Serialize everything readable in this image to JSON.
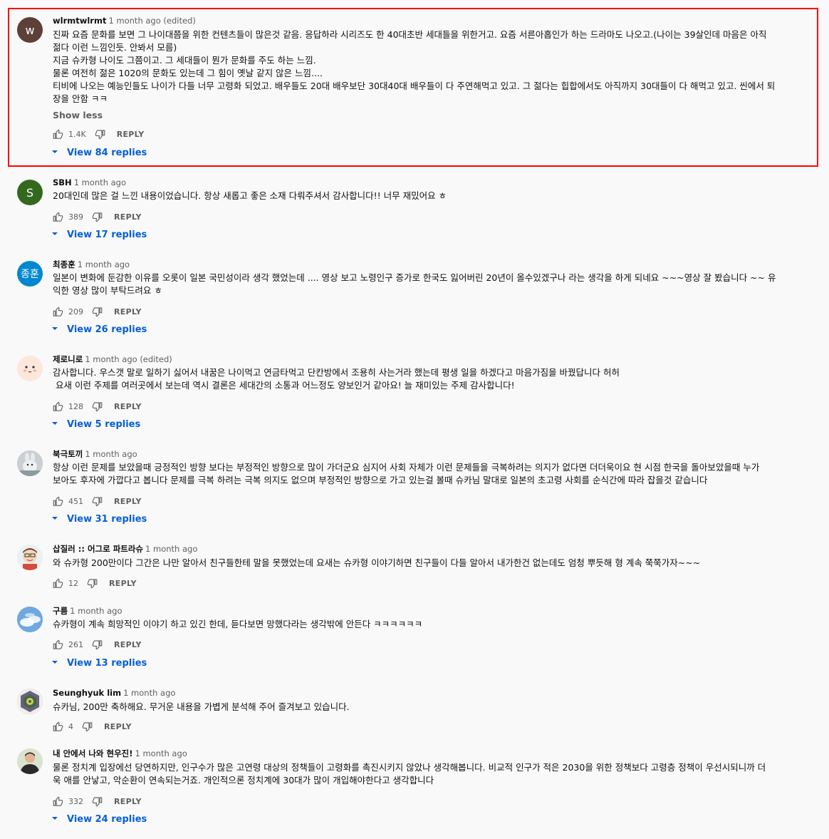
{
  "comments": [
    {
      "author": "wlrmtwlrmt",
      "time": "1 month ago (edited)",
      "avatar": {
        "kind": "letter",
        "letter": "w",
        "color": "#5d4037"
      },
      "text": "진짜 요즘 문화를 보면 그 나이대쯤을 위한 컨텐츠들이 많은것 같음. 응답하라 시리즈도 한 40대초반 세대들을 위한거고. 요즘 서른아홉인가 하는 드라마도 나오고.(나이는 39살인데 마음은 아직\n젊다 이런 느낌인듯. 안봐서 모름)\n지금 슈카형 나이도 그쯤이고. 그 세대들이 뭔가 문화를 주도 하는 느낌.\n물론 여전히 젊은 1020의 문화도 있는데 그 힘이 옛날 같지 않은 느낌....\n티비에 나오는 예능인들도 나이가 다들 너무 고령화 되었고. 배우들도 20대 배우보단 30대40대 배우들이 다 주연해먹고 있고. 그 젊다는 힙합에서도 아직까지 30대들이 다 해먹고 있고. 씬에서 퇴\n장을 안함 ㅋㅋ",
      "show_less": "Show less",
      "likes": "1.4K",
      "reply_label": "REPLY",
      "replies": "View 84 replies"
    },
    {
      "author": "SBH",
      "time": "1 month ago",
      "avatar": {
        "kind": "letter",
        "letter": "S",
        "color": "#33691e"
      },
      "text": "20대인데 많은 걸 느낀 내용이었습니다. 항상 새롭고 좋은 소재 다뤄주셔서 감사합니다!! 너무 재밌어요 ㅎ",
      "likes": "389",
      "reply_label": "REPLY",
      "replies": "View 17 replies"
    },
    {
      "author": "최종훈",
      "time": "1 month ago",
      "avatar": {
        "kind": "letter",
        "letter": "종훈",
        "color": "#0288d1"
      },
      "text": "일본이 변화에 둔감한 이유를 오롯이 일본 국민성이라 생각 했었는데 .... 영상 보고 노령인구 증가로 한국도 잃어버린 20년이 올수있겠구나 라는 생각을 하게 되네요 ~~~영상 잘 봤습니다 ~~ 유\n익한 영상 많이 부탁드려요 ㅎ",
      "likes": "209",
      "reply_label": "REPLY",
      "replies": "View 26 replies"
    },
    {
      "author": "제로니로",
      "time": "1 month ago (edited)",
      "avatar": {
        "kind": "face",
        "color": "#fde7dc"
      },
      "text": "감사합니다. 우스갯 말로 일하기 싫어서 내꿈은 나이먹고 연금타먹고 단칸방에서 조용히 사는거라 했는데 평생 일을 하겠다고 마음가짐을 바꿨답니다 허허\n 요새 이런 주제를 여러곳에서 보는데 역시 결론은 세대간의 소통과 어느정도 양보인거 같아요! 늘 재미있는 주제 감사합니다!",
      "likes": "128",
      "reply_label": "REPLY",
      "replies": "View 5 replies"
    },
    {
      "author": "북극토끼",
      "time": "1 month ago",
      "avatar": {
        "kind": "photo",
        "color": "#9aa3a8"
      },
      "text": "항상 이런 문제를 보았을때 긍정적인 방향 보다는 부정적인 방향으로 많이 가더군요 심지어 사회 자체가 이런 문제들을 극복하려는 의지가 없다면 더더욱이요 현 시점 한국을 돌아보았을때 누가\n보아도 후자에 가깝다고 봅니다 문제를 극복 하려는 극복 의지도 없으며 부정적인 방향으로 가고 있는걸 볼때 슈카님 말대로 일본의 초고령 사회를 순식간에 따라 잡을것 같습니다",
      "likes": "451",
      "reply_label": "REPLY",
      "replies": "View 31 replies"
    },
    {
      "author": "삽질러 :: 어그로 파트라슈",
      "time": "1 month ago",
      "avatar": {
        "kind": "cartoon",
        "color": "#f3e5ce"
      },
      "text": "와 슈카형 200만이다 그간은 나만 알아서 친구들한테 말을 못했었는데 요새는 슈카형 이야기하면 친구들이 다들 알아서 내가한건 없는데도 엄청 뿌듯해 형 계속 쭉쭉가자~~~",
      "likes": "12",
      "reply_label": "REPLY",
      "replies": ""
    },
    {
      "author": "구름",
      "time": "1 month ago",
      "avatar": {
        "kind": "sky",
        "color": "#7fb3e6"
      },
      "text": "슈카형이 계속 희망적인 이야기 하고 있긴 한데, 듣다보면 망했다라는 생각밖에 안든다 ㅋㅋㅋㅋㅋㅋ",
      "likes": "261",
      "reply_label": "REPLY",
      "replies": "View 13 replies"
    },
    {
      "author": "Seunghyuk lim",
      "time": "1 month ago",
      "avatar": {
        "kind": "emblem",
        "color": "#7a8a6a"
      },
      "text": "슈카님, 200만 축하해요. 무거운 내용을 가볍게 분석해 주어 즐겨보고 있습니다.",
      "likes": "4",
      "reply_label": "REPLY",
      "replies": ""
    },
    {
      "author": "내 안에서 나와 현우진!",
      "time": "1 month ago",
      "avatar": {
        "kind": "person",
        "color": "#d8e0cf"
      },
      "text": "물론 정치계 입장에선 당연하지만, 인구수가 많은 고연령 대상의 정책들이 고령화를 촉진시키지 않았나 생각해봅니다. 비교적 인구가 적은 2030을 위한 정책보다 고령층 정책이 우선시되니까 더\n욱 애를 안낳고, 악순환이 연속되는거죠. 개인적으론 정치계에 30대가 많이 개입해야한다고 생각합니다",
      "likes": "332",
      "reply_label": "REPLY",
      "replies": "View 24 replies"
    }
  ]
}
